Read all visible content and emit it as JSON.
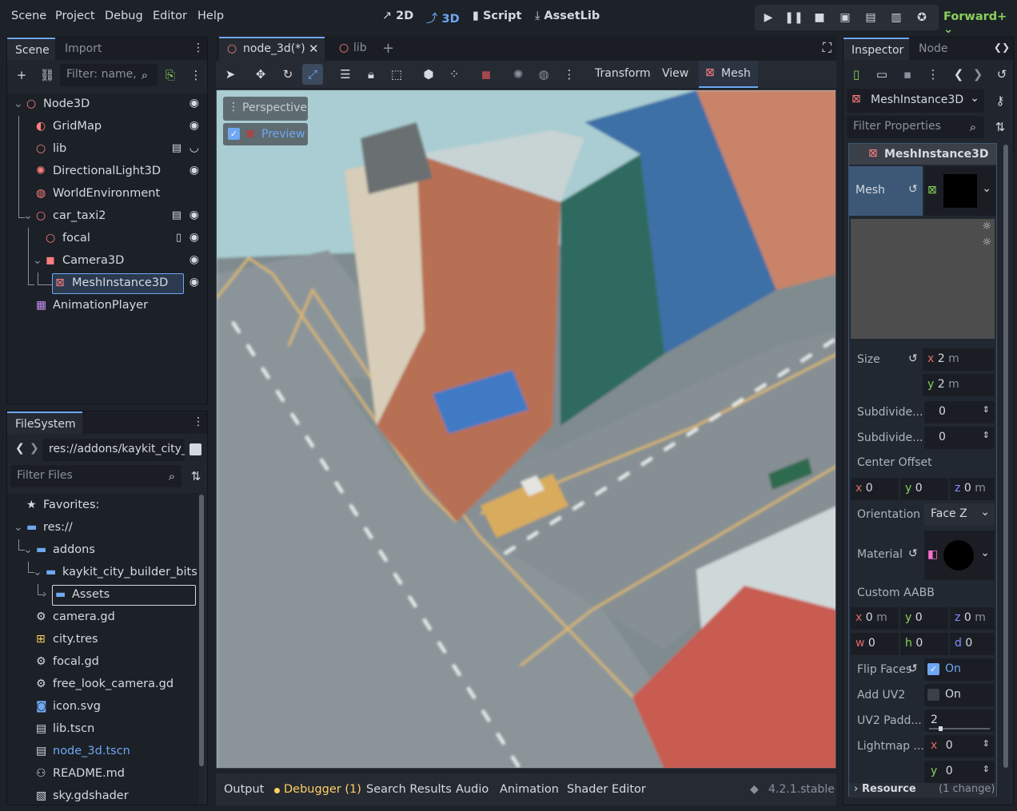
{
  "menu": [
    "Scene",
    "Project",
    "Debug",
    "Editor",
    "Help"
  ],
  "workspaces": {
    "w2d": "2D",
    "w3d": "3D",
    "script": "Script",
    "assetlib": "AssetLib"
  },
  "renderer": "Forward+",
  "scene_dock": {
    "tabs": [
      "Scene",
      "Import"
    ],
    "filter_placeholder": "Filter: name,",
    "tree": [
      {
        "label": "Node3D",
        "icon": "node3d-icon"
      },
      {
        "label": "GridMap",
        "icon": "gridmap-icon"
      },
      {
        "label": "lib",
        "icon": "node3d-icon"
      },
      {
        "label": "DirectionalLight3D",
        "icon": "light-icon"
      },
      {
        "label": "WorldEnvironment",
        "icon": "globe-icon"
      },
      {
        "label": "car_taxi2",
        "icon": "node3d-icon"
      },
      {
        "label": "focal",
        "icon": "node3d-icon"
      },
      {
        "label": "Camera3D",
        "icon": "camera-icon"
      },
      {
        "label": "MeshInstance3D",
        "icon": "mesh-icon"
      },
      {
        "label": "AnimationPlayer",
        "icon": "animation-icon"
      }
    ]
  },
  "filesystem": {
    "tab": "FileSystem",
    "path": "res://addons/kaykit_city_",
    "filter_placeholder": "Filter Files",
    "items": [
      {
        "label": "Favorites:",
        "icon": "star-icon"
      },
      {
        "label": "res://",
        "icon": "folder-icon"
      },
      {
        "label": "addons",
        "icon": "folder-icon"
      },
      {
        "label": "kaykit_city_builder_bits",
        "icon": "folder-icon"
      },
      {
        "label": "Assets",
        "icon": "folder-icon"
      },
      {
        "label": "camera.gd",
        "icon": "gear-icon"
      },
      {
        "label": "city.tres",
        "icon": "resource-icon"
      },
      {
        "label": "focal.gd",
        "icon": "gear-icon"
      },
      {
        "label": "free_look_camera.gd",
        "icon": "gear-icon"
      },
      {
        "label": "icon.svg",
        "icon": "image-icon"
      },
      {
        "label": "lib.tscn",
        "icon": "scene-icon"
      },
      {
        "label": "node_3d.tscn",
        "icon": "scene-icon"
      },
      {
        "label": "README.md",
        "icon": "readme-icon"
      },
      {
        "label": "sky.gdshader",
        "icon": "shader-icon"
      }
    ]
  },
  "editor_tabs": [
    "node_3d(*)",
    "lib"
  ],
  "viewport_toolbar": {
    "transform": "Transform",
    "view": "View",
    "mesh": "Mesh"
  },
  "viewport": {
    "perspective": "Perspective",
    "preview": "Preview"
  },
  "bottom_tabs": [
    "Output",
    "Debugger (1)",
    "Search Results",
    "Audio",
    "Animation",
    "Shader Editor"
  ],
  "version": "4.2.1.stable",
  "inspector": {
    "tabs": [
      "Inspector",
      "Node"
    ],
    "node_type": "MeshInstance3D",
    "filter_placeholder": "Filter Properties",
    "section": "MeshInstance3D",
    "mesh_label": "Mesh",
    "size_label": "Size",
    "size_x": "2",
    "size_y": "2",
    "unit": "m",
    "subdiv1_label": "Subdivide...",
    "subdiv1": "0",
    "subdiv2_label": "Subdivide...",
    "subdiv2": "0",
    "center_offset_label": "Center Offset",
    "co_x": "0",
    "co_y": "0",
    "co_z": "0",
    "orientation_label": "Orientation",
    "orientation": "Face Z",
    "material_label": "Material",
    "aabb_label": "Custom AABB",
    "aabb_x": "0",
    "aabb_y": "0",
    "aabb_z": "0",
    "aabb_w": "0",
    "aabb_h": "0",
    "aabb_d": "0",
    "flip_faces_label": "Flip Faces",
    "flip_faces": "On",
    "add_uv2_label": "Add UV2",
    "add_uv2": "On",
    "uv2_pad_label": "UV2 Padd...",
    "uv2_pad": "2",
    "lightmap_label": "Lightmap ...",
    "lm_x": "0",
    "lm_y": "0",
    "resource_label": "Resource",
    "changes": "(1 change)"
  }
}
